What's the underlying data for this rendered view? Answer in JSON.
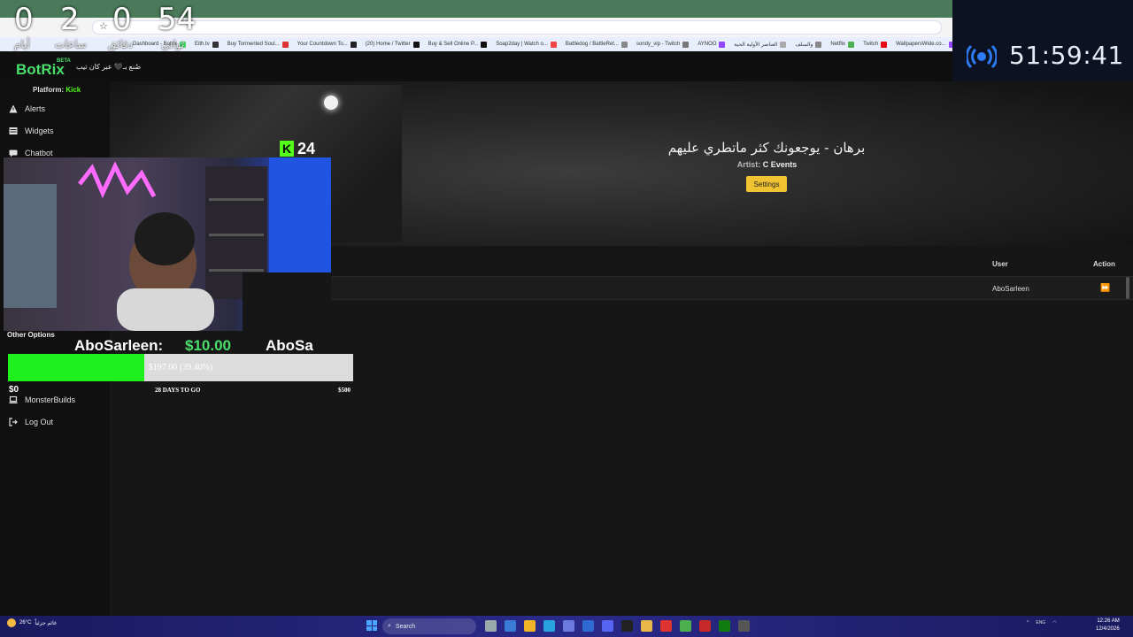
{
  "countdown": {
    "values": [
      "0",
      "2",
      "0",
      "54"
    ],
    "labels": [
      "أيام",
      "ساعات",
      "دقائق",
      "ثواني"
    ]
  },
  "timer": {
    "time": "51:59:41"
  },
  "browser": {
    "bookmarks": [
      "Dashboard - Botrix",
      "Eith.tv",
      "Buy Tormented Soul...",
      "Your Countdown To...",
      "(20) Home / Twitter",
      "Buy & Sell Online P...",
      "Soap2day | Watch o...",
      "Battledog / BattleRet...",
      "sondy_vip - Twitch",
      "AYNOO",
      "العناصر الأولية الحية",
      "والسلف",
      "Netflix",
      "Twitch",
      "WallpapersWide.co..."
    ]
  },
  "app": {
    "logo": "BotRix",
    "beta": "BETA",
    "tagline": "صُنع بـ🖤 عبر كان تيب",
    "platform_label": "Platform:",
    "platform_value": "Kick"
  },
  "sidebar": {
    "items": [
      {
        "label": "Alerts",
        "icon": "warning-icon"
      },
      {
        "label": "Widgets",
        "icon": "widgets-icon"
      },
      {
        "label": "Chatbot",
        "icon": "chat-icon"
      },
      {
        "label": "MonsterBuilds",
        "icon": "laptop-icon"
      },
      {
        "label": "Log Out",
        "icon": "logout-icon"
      }
    ],
    "other_options": "Other Options"
  },
  "song": {
    "title": "برهان - يوجعونك كثر ماتطري عليهم",
    "artist_label": "Artist:",
    "artist": "C Events",
    "settings": "Settings"
  },
  "table": {
    "headers": {
      "user": "User",
      "action": "Action"
    },
    "rows": [
      {
        "user": "AboSarleen",
        "action": "⏩"
      }
    ]
  },
  "kick": {
    "count": "24",
    "logo": "K"
  },
  "donation": {
    "name": "AboSarleen:",
    "amount": "$10.00",
    "name2": "AboSa"
  },
  "goal": {
    "progress_text": "$197.00 (39.40%)",
    "progress_fraction": 0.394,
    "min": "$0",
    "days": "28 DAYS TO GO",
    "max": "$500"
  },
  "taskbar": {
    "temp": "26°C",
    "weather": "غائم جزئياً",
    "search": "Search",
    "lang": "ENG",
    "time": "12:26 AM",
    "date": "12/4/2026"
  },
  "colors": {
    "accent_green": "#4ade6b",
    "kick_green": "#53fc18",
    "settings_yellow": "#f1c232",
    "goal_fill": "#1ef01e"
  }
}
